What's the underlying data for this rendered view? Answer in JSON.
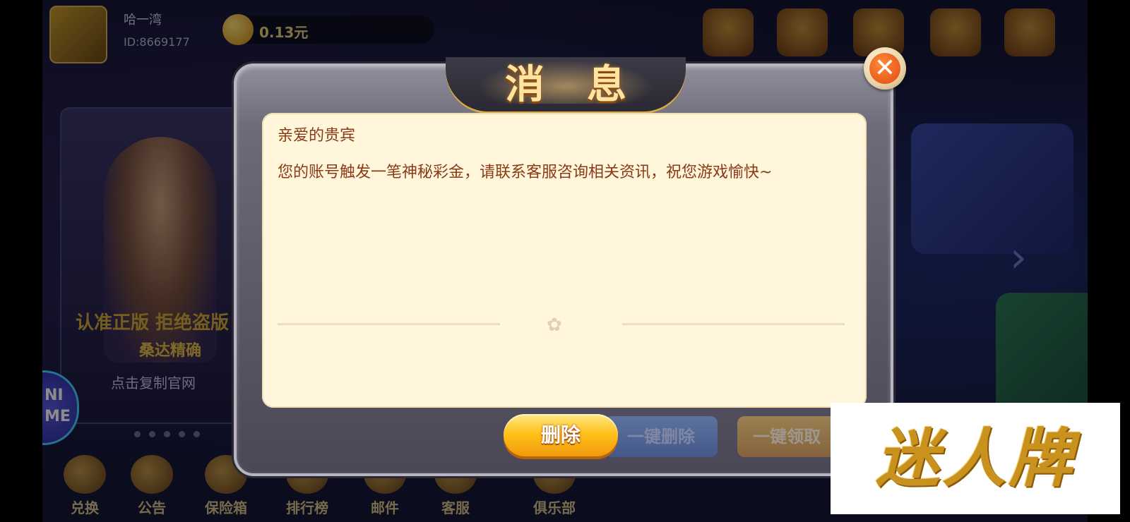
{
  "player": {
    "name": "哈一湾",
    "id": "ID:8669177",
    "coins": "0.13元"
  },
  "banner": {
    "line1": "认准正版 拒绝盗版",
    "line2": "桑达精确",
    "line3": "点击复制官网"
  },
  "mini_game": {
    "line1": "NI",
    "line2": "ME"
  },
  "bottom_nav": [
    "兑换",
    "公告",
    "保险箱",
    "排行榜",
    "邮件",
    "客服",
    "俱乐部"
  ],
  "dialog": {
    "title": "消息",
    "close_symbol": "✕",
    "greeting": "亲爱的贵宾",
    "body": "您的账号触发一笔神秘彩金，请联系客服咨询相关资讯，祝您游戏愉快~",
    "buttons": {
      "delete": "删除",
      "delete_all": "一键删除",
      "claim_all": "一键领取"
    }
  },
  "watermark": {
    "text": "迷人牌"
  },
  "colors": {
    "accent_orange": "#f09a0a",
    "text_brown": "#8a3a14",
    "panel_cream": "#fff6dc"
  }
}
